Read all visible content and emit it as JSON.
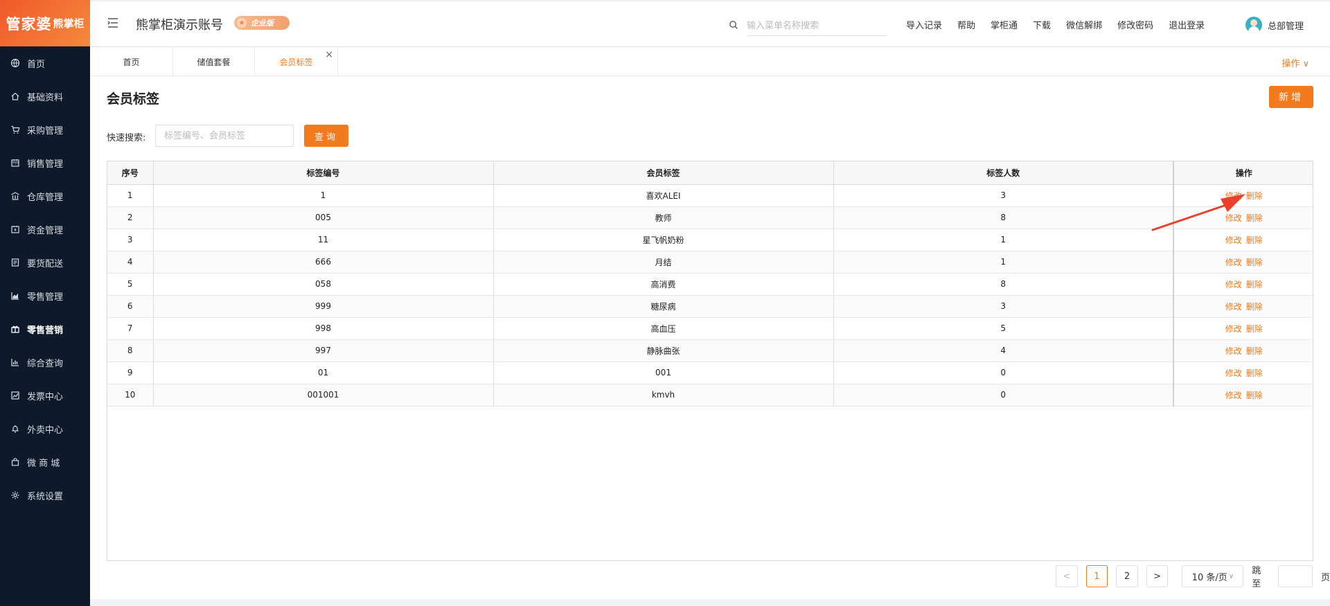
{
  "logo": {
    "main": "管家婆",
    "sub": "熊掌柜"
  },
  "sidebar": {
    "items": [
      {
        "label": "首页",
        "icon": "globe-icon",
        "active": false
      },
      {
        "label": "基础资料",
        "icon": "home-icon",
        "active": false
      },
      {
        "label": "采购管理",
        "icon": "cart-icon",
        "active": false
      },
      {
        "label": "销售管理",
        "icon": "calendar-icon",
        "active": false
      },
      {
        "label": "仓库管理",
        "icon": "bank-icon",
        "active": false
      },
      {
        "label": "资金管理",
        "icon": "calendar-check-icon",
        "active": false
      },
      {
        "label": "要货配送",
        "icon": "document-icon",
        "active": false
      },
      {
        "label": "零售管理",
        "icon": "area-chart-icon",
        "active": false
      },
      {
        "label": "零售营销",
        "icon": "gift-icon",
        "active": true
      },
      {
        "label": "综合查询",
        "icon": "bar-chart-icon",
        "active": false
      },
      {
        "label": "发票中心",
        "icon": "line-chart-icon",
        "active": false
      },
      {
        "label": "外卖中心",
        "icon": "bell-icon",
        "active": false
      },
      {
        "label": "微 商 城",
        "icon": "bag-icon",
        "active": false
      },
      {
        "label": "系统设置",
        "icon": "gear-icon",
        "active": false
      }
    ]
  },
  "header": {
    "account_title": "熊掌柜演示账号",
    "edition": "企业版",
    "search_placeholder": "输入菜单名称搜索",
    "links": [
      "导入记录",
      "帮助",
      "掌柜通",
      "下载",
      "微信解绑",
      "修改密码",
      "退出登录"
    ],
    "username": "总部管理"
  },
  "tabs": [
    {
      "label": "首页",
      "active": false
    },
    {
      "label": "储值套餐",
      "active": false
    },
    {
      "label": "会员标签",
      "active": true
    }
  ],
  "ops_menu": "操作 ∨",
  "page": {
    "title": "会员标签",
    "add_label": "新增",
    "quick_search_label": "快速搜索:",
    "quick_search_placeholder": "标签编号、会员标签",
    "query_label": "查询"
  },
  "table": {
    "columns": [
      "序号",
      "标签编号",
      "会员标签",
      "标签人数",
      "操作"
    ],
    "edit_label": "修改",
    "delete_label": "删除",
    "rows": [
      {
        "seq": "1",
        "code": "1",
        "tag": "喜欢ALEI",
        "count": "3"
      },
      {
        "seq": "2",
        "code": "005",
        "tag": "教师",
        "count": "8"
      },
      {
        "seq": "3",
        "code": "11",
        "tag": "星飞帆奶粉",
        "count": "1"
      },
      {
        "seq": "4",
        "code": "666",
        "tag": "月结",
        "count": "1"
      },
      {
        "seq": "5",
        "code": "058",
        "tag": "高消费",
        "count": "8"
      },
      {
        "seq": "6",
        "code": "999",
        "tag": "糖尿病",
        "count": "3"
      },
      {
        "seq": "7",
        "code": "998",
        "tag": "高血压",
        "count": "5"
      },
      {
        "seq": "8",
        "code": "997",
        "tag": "静脉曲张",
        "count": "4"
      },
      {
        "seq": "9",
        "code": "01",
        "tag": "001",
        "count": "0"
      },
      {
        "seq": "10",
        "code": "001001",
        "tag": "kmvh",
        "count": "0"
      }
    ]
  },
  "pagination": {
    "prev": "<",
    "pages": [
      "1",
      "2"
    ],
    "current": "1",
    "next": ">",
    "page_size": "10 条/页",
    "jump_label": "跳至",
    "page_unit": "页"
  },
  "colors": {
    "accent": "#f37b1d",
    "sidebar_bg": "#0e1a2b",
    "annotation_arrow": "#e8412c"
  }
}
